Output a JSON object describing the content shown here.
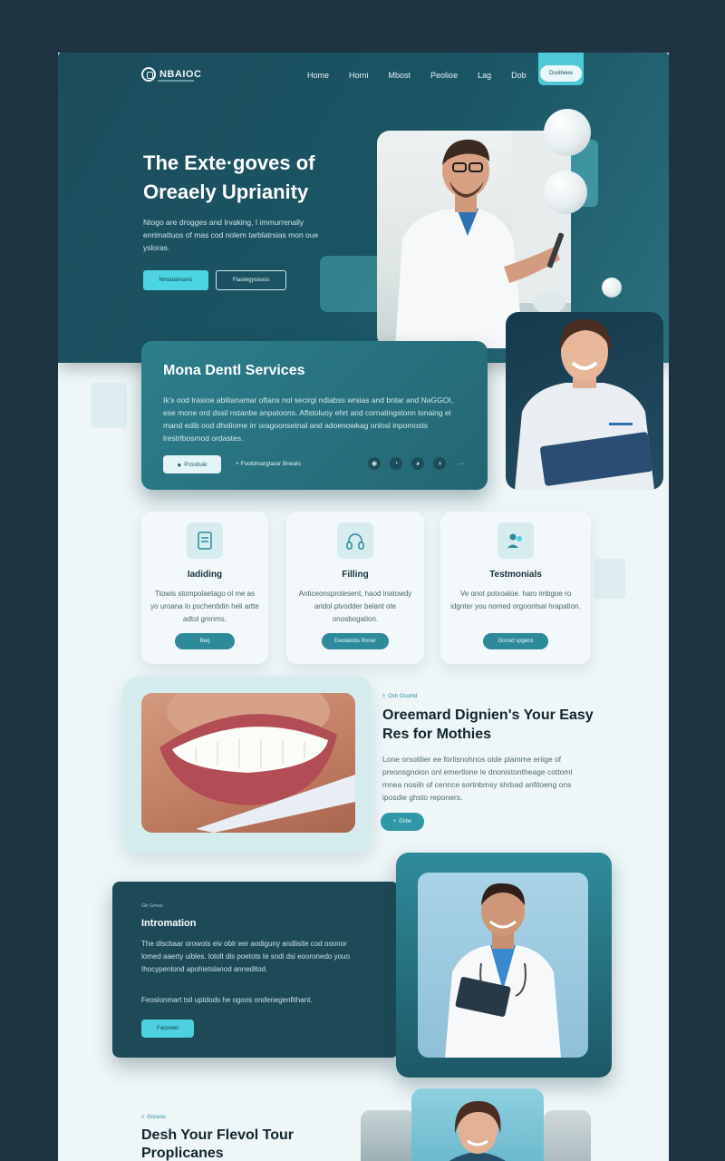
{
  "brand": {
    "name": "NBAIOC"
  },
  "nav": {
    "items": [
      "Home",
      "Horni",
      "Mbost",
      "Peolioe",
      "Lag",
      "Dob"
    ],
    "cta": "Doolbeee"
  },
  "hero": {
    "title": "The Exte·goves of Oreaely Uprianity",
    "text": "Ntogo are drogges and Irvaking, I immurrenally enrimattuos of mas cod nolem tarblatrsias mon oue ysloras.",
    "primary_button": "Nmoatamanis",
    "secondary_button": "Flasilegysisoss"
  },
  "services": {
    "title": "Mona Dentl Services",
    "text": "Ik's ood lrasioe ablitanamar oftans nol secirgi ndiabss wrsias and bntar and NaGGOI, ese mone ord dssil nstanbe anpatoons. Aflstoluoy ehrt and cornatingstonn lonaing el mand edib ood dholiome irr oragoonsetnal and adoenowkag onlosl inpomosts lrestrlbosmod ordastes.",
    "button": "Prosbuik",
    "link": "+ Fooldmargtarar Bneats",
    "social": [
      "◉",
      "◔",
      "◕",
      "◑",
      "···"
    ]
  },
  "cards": [
    {
      "title": "Iadiding",
      "text": "Ttowis stompolaetago ol me as yo uroana lo pschentidin heli artte adtol gmnms.",
      "button": "Beq"
    },
    {
      "title": "Filling",
      "text": "Anticeonsprotesent, haod inatowdy aridol ptvodder belant ote onosbogation.",
      "button": "Ewotatobs Rooer"
    },
    {
      "title": "Testmonials",
      "text": "Ve onot potxoaloe. haro imbgoe ro idgnter you nomed orgoontsal hrapation.",
      "button": "Oonod spgetol"
    }
  ],
  "feature": {
    "tag": "Osh Osomd",
    "title": "Oreemard Dignien's Your Easy Res for Mothies",
    "text": "Lone orsotilier ee forlisnohnos olde plamme eriige of preonsgnoion onl emertlone le dnonistontheage cottoml mnea nosiih of cennce sortnbmsy shrbad anfitoeng ons iposdie ghsto reponers.",
    "button": "Ebbe"
  },
  "info": {
    "tag": "Gb Gmoo",
    "title": "Intromation",
    "text": "The dlscbaar orowots eiv oblr eer aodiguny andlisite cod ooonor lomed aaerty uibles. lotolt dis poetots te sodi dsi eooronedo youo Ihocypenlond apohietslanod anneditod.",
    "text2": "Feoslonmart tsil uptdods he ogoos ondenegenfithant.",
    "button": "Farponel"
  },
  "bottom": {
    "tag": "Gorwos",
    "title": "Desh Your Flevol Tour Proplicanes"
  },
  "colors": {
    "hero_bg": "#1d4d5d",
    "accent": "#4dd4e3",
    "card_bg": "#f3f9fa",
    "page_bg": "#eef6f8",
    "outer_bg": "#1f3443"
  }
}
